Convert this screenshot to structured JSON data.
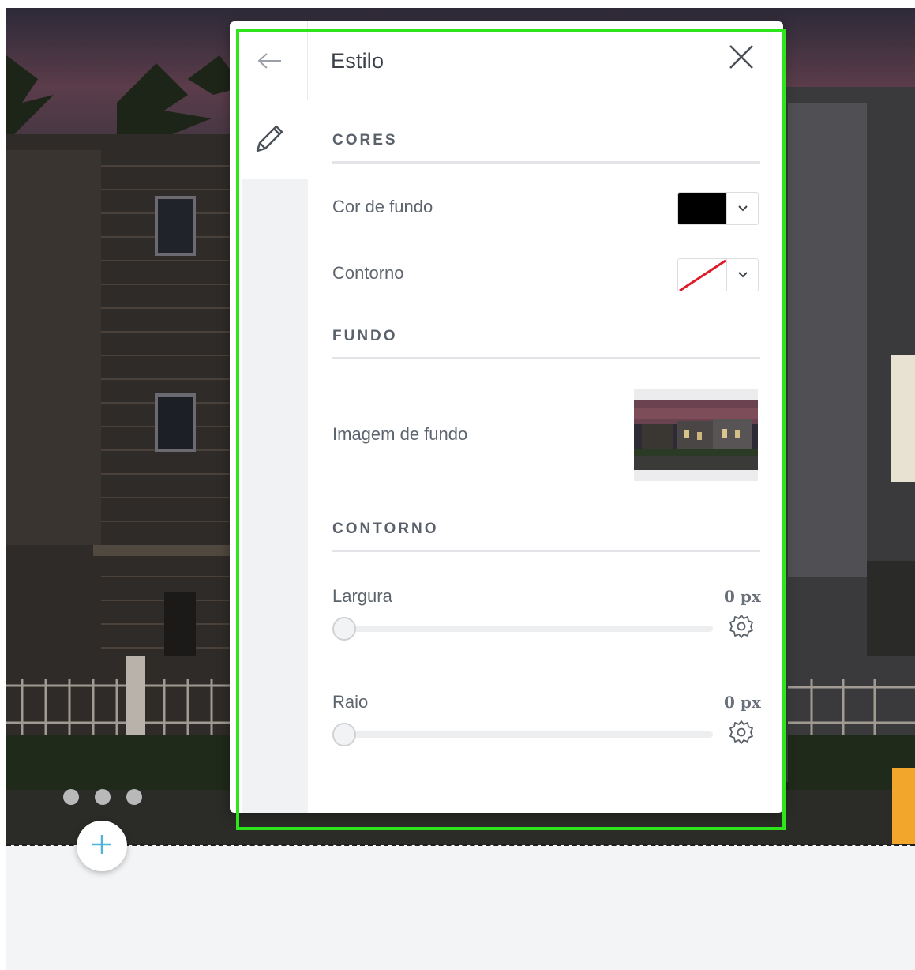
{
  "panel": {
    "title": "Estilo",
    "back_icon": "arrow-left-icon",
    "close_icon": "close-icon",
    "active_tab_icon": "pencil-icon"
  },
  "sections": {
    "cores": {
      "heading": "CORES",
      "background_color": {
        "label": "Cor de fundo",
        "value": "#000000"
      },
      "outline_color": {
        "label": "Contorno",
        "value": "none"
      }
    },
    "fundo": {
      "heading": "FUNDO",
      "background_image": {
        "label": "Imagem de fundo"
      }
    },
    "contorno": {
      "heading": "CONTORNO",
      "width": {
        "label": "Largura",
        "value": "0 px",
        "slider_fraction": 0
      },
      "radius": {
        "label": "Raio",
        "value": "0 px",
        "slider_fraction": 0
      }
    }
  },
  "canvas": {
    "slide_count": 3,
    "add_icon": "plus-icon"
  },
  "colors": {
    "highlight": "#2ee51c",
    "accent_orange": "#f2a62b",
    "add_icon": "#4fb3d9",
    "no_color_slash": "#e0192b"
  }
}
